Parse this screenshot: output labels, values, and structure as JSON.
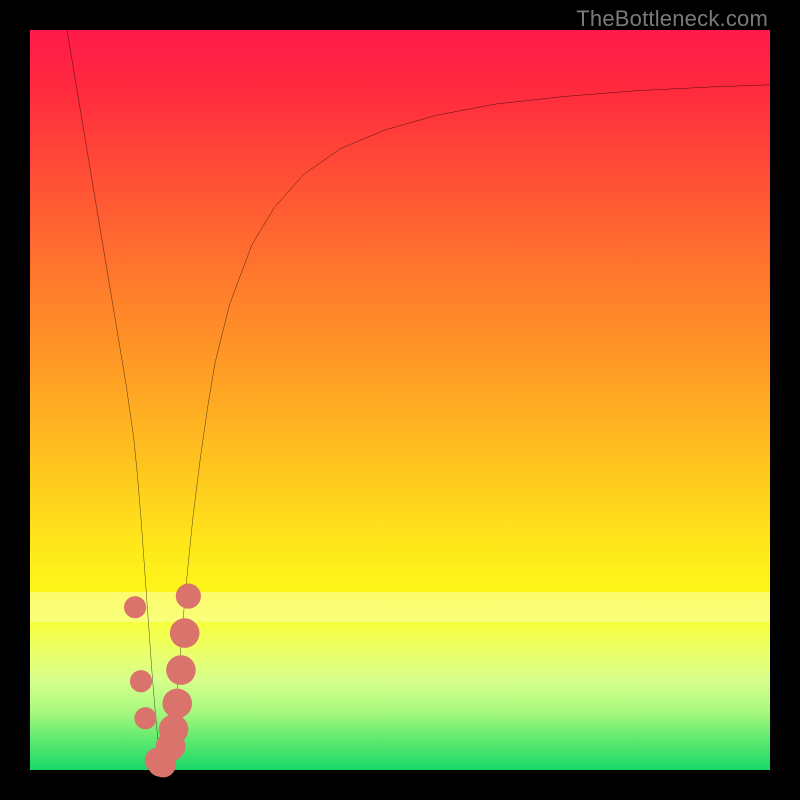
{
  "watermark": "TheBottleneck.com",
  "colors": {
    "frame": "#000000",
    "curve": "#000000",
    "marker": "#d9736b",
    "gradient_top": "#ff1a4a",
    "gradient_bottom": "#19d86a"
  },
  "chart_data": {
    "type": "line",
    "title": "",
    "xlabel": "",
    "ylabel": "",
    "xlim": [
      0,
      100
    ],
    "ylim": [
      0,
      100
    ],
    "grid": false,
    "legend": false,
    "series": [
      {
        "name": "curve",
        "x": [
          5,
          7,
          9,
          11,
          12,
          13,
          14,
          14.5,
          15,
          15.5,
          16,
          16.5,
          17,
          17.3,
          17.6,
          18,
          18.5,
          19,
          19.5,
          20,
          20.5,
          21,
          22,
          23,
          24,
          25,
          27,
          30,
          33,
          37,
          42,
          48,
          55,
          63,
          72,
          82,
          92,
          100
        ],
        "y": [
          100,
          88,
          76,
          64,
          58,
          52,
          45,
          40,
          34,
          27,
          20,
          13,
          7,
          4,
          2,
          0.5,
          1,
          3,
          7,
          12,
          18,
          24,
          34,
          42,
          49,
          55,
          63,
          71,
          76,
          80.5,
          84,
          86.5,
          88.5,
          90,
          91,
          91.8,
          92.3,
          92.6
        ]
      }
    ],
    "markers": [
      {
        "x": 14.2,
        "y": 22,
        "r": 1.5
      },
      {
        "x": 15.0,
        "y": 12,
        "r": 1.5
      },
      {
        "x": 15.6,
        "y": 7,
        "r": 1.5
      },
      {
        "x": 17.2,
        "y": 1.3,
        "r": 1.7
      },
      {
        "x": 17.6,
        "y": 0.8,
        "r": 1.7
      },
      {
        "x": 18.0,
        "y": 0.7,
        "r": 1.7
      },
      {
        "x": 19.0,
        "y": 3.2,
        "r": 2.0
      },
      {
        "x": 19.4,
        "y": 5.5,
        "r": 2.0
      },
      {
        "x": 19.9,
        "y": 9.0,
        "r": 2.0
      },
      {
        "x": 20.4,
        "y": 13.5,
        "r": 2.0
      },
      {
        "x": 20.9,
        "y": 18.5,
        "r": 2.0
      },
      {
        "x": 21.4,
        "y": 23.5,
        "r": 1.7
      }
    ],
    "pale_band": {
      "y0": 20,
      "y1": 24
    }
  }
}
